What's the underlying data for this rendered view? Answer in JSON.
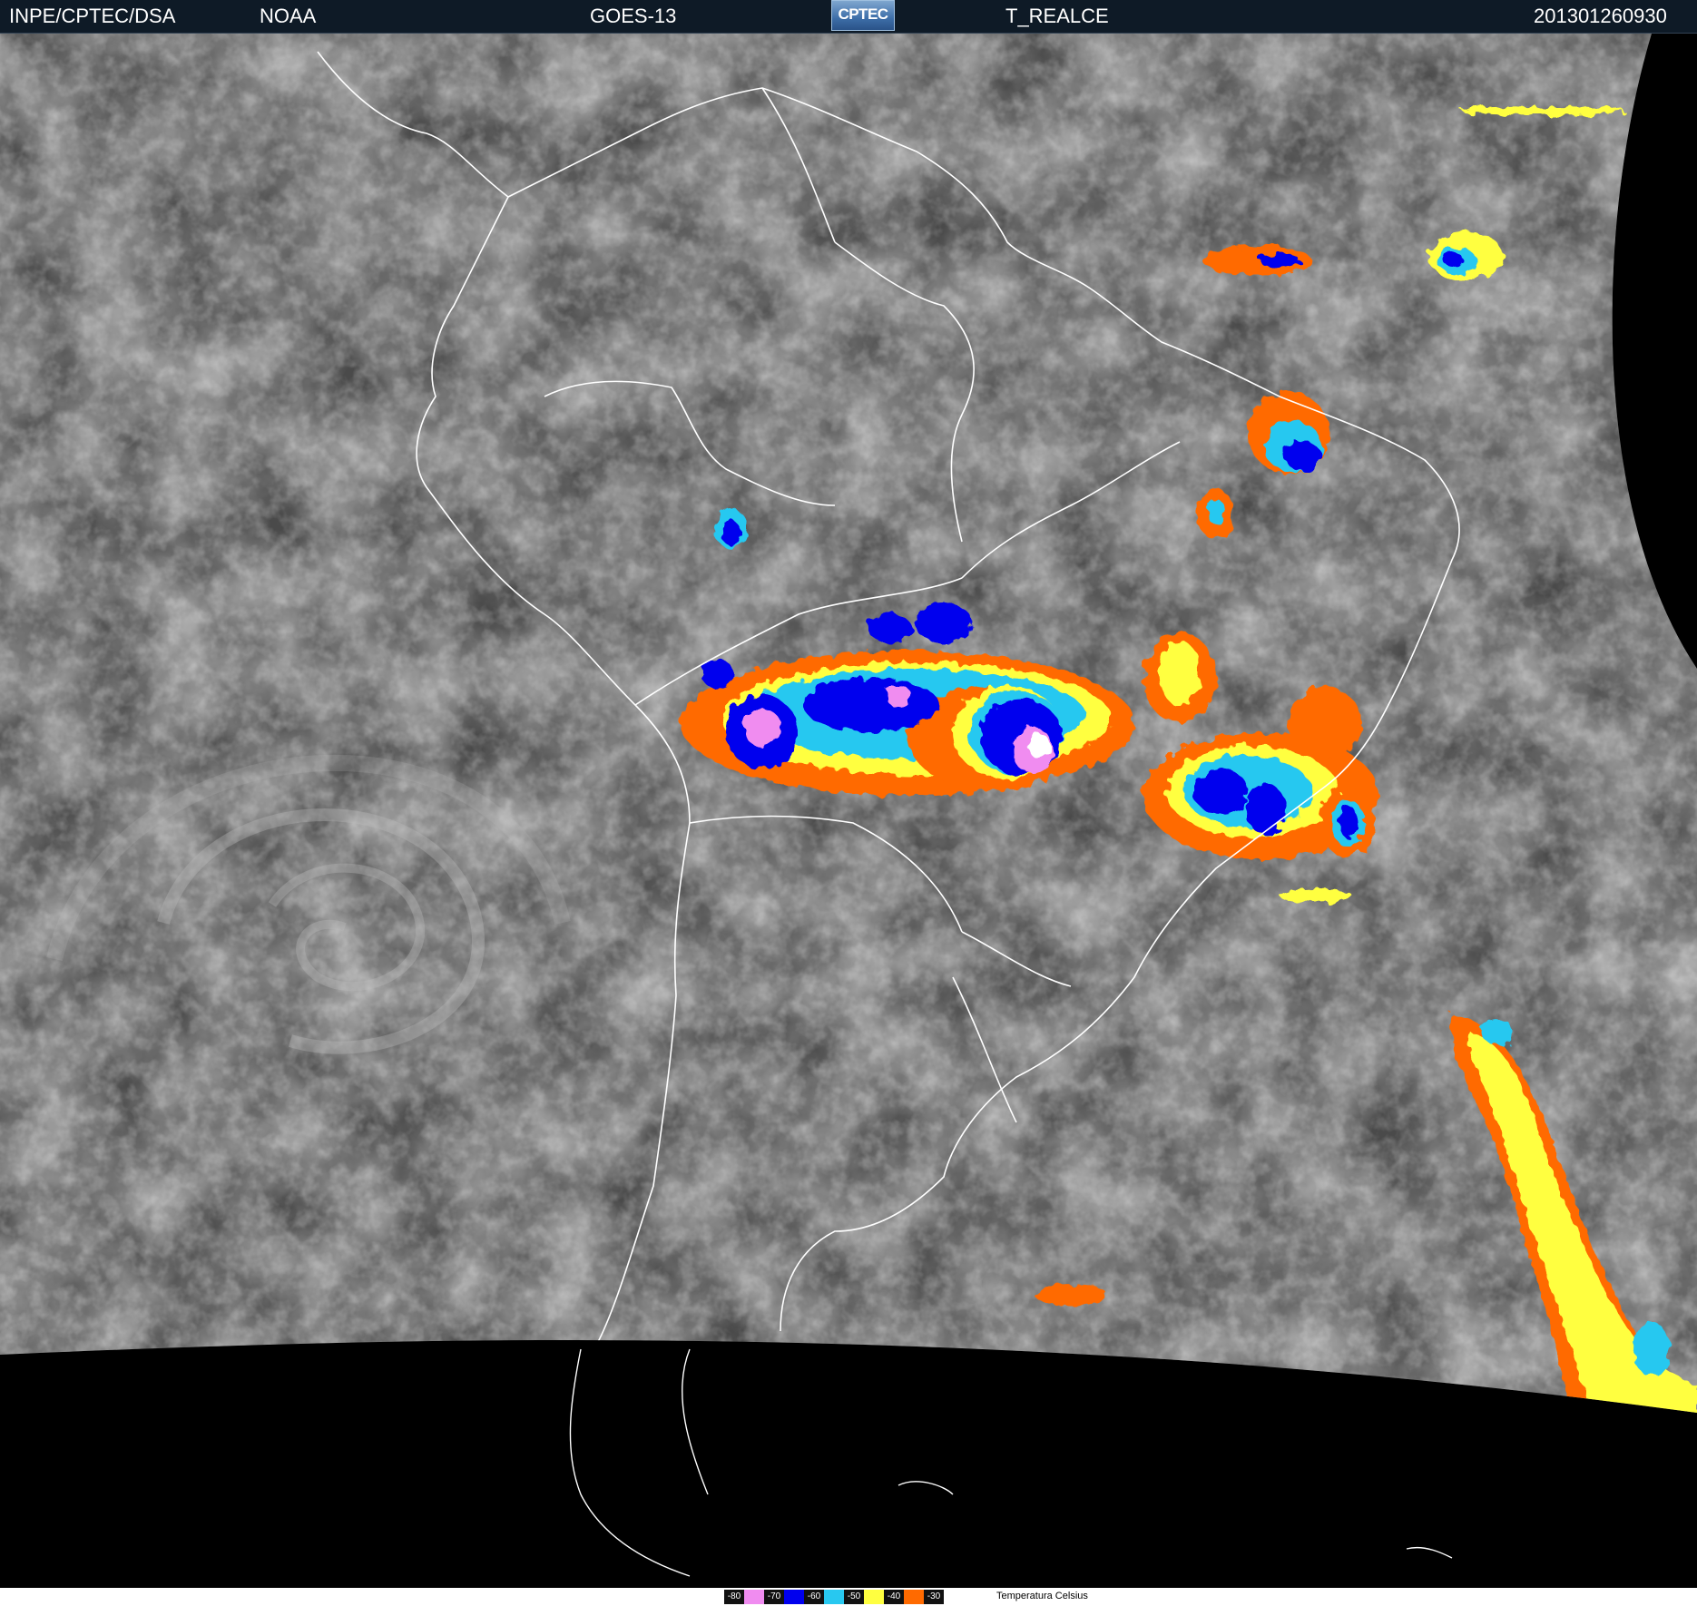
{
  "header": {
    "agency": "INPE/CPTEC/DSA",
    "source": "NOAA",
    "satellite": "GOES-13",
    "logo_text": "CPTEC",
    "product": "T_REALCE",
    "timestamp": "201301260930"
  },
  "legend": {
    "items": [
      {
        "label": "-80",
        "color": "#f08cf0"
      },
      {
        "label": "-70",
        "color": "#0000ee"
      },
      {
        "label": "-60",
        "color": "#28c8f0"
      },
      {
        "label": "-50",
        "color": "#ffff40"
      },
      {
        "label": "-40",
        "color": "#ff6a00"
      },
      {
        "label": "-30",
        "color": "#000000"
      }
    ],
    "title": "Temperatura   Celsius"
  },
  "colors": {
    "header_bg": "#0e1a26",
    "cloud_gray": "#8a8a8a",
    "ocean_gray": "#4a4a4a",
    "coastline": "#ffffff",
    "space": "#000000"
  },
  "icons": {
    "logo": "cptec-logo-icon"
  }
}
